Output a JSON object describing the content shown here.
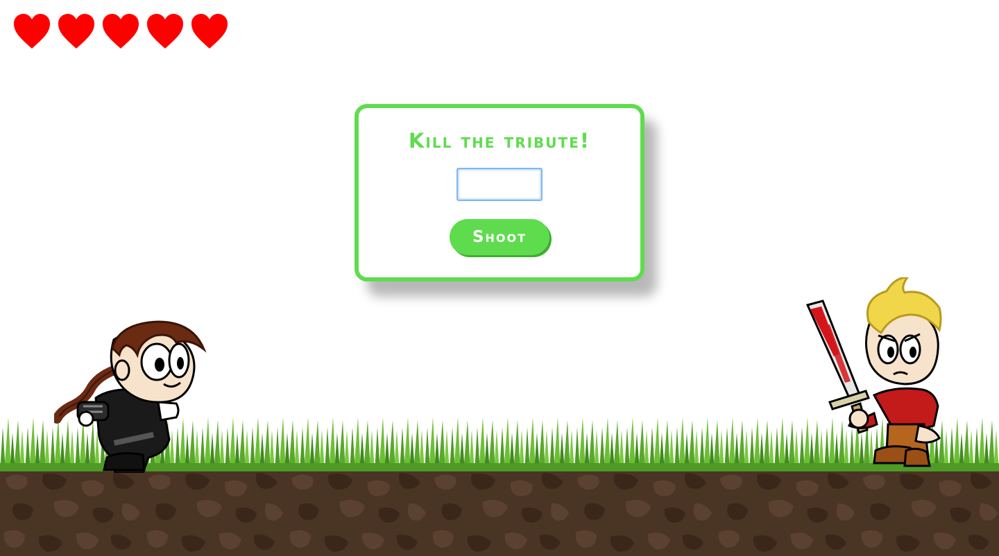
{
  "hud": {
    "lives": 5,
    "heart_icon": "heart-icon",
    "heart_color": "#ff0000"
  },
  "dialog": {
    "title": "Kill the tribute!",
    "answer_value": "",
    "shoot_label": "Shoot",
    "accent_color": "#5fdc4e"
  },
  "scene": {
    "player_icon": "katniss-sprite",
    "enemy_icon": "tribute-with-sword-sprite",
    "grass_color": "#5aa82c",
    "dirt_color": "#4a3424"
  }
}
